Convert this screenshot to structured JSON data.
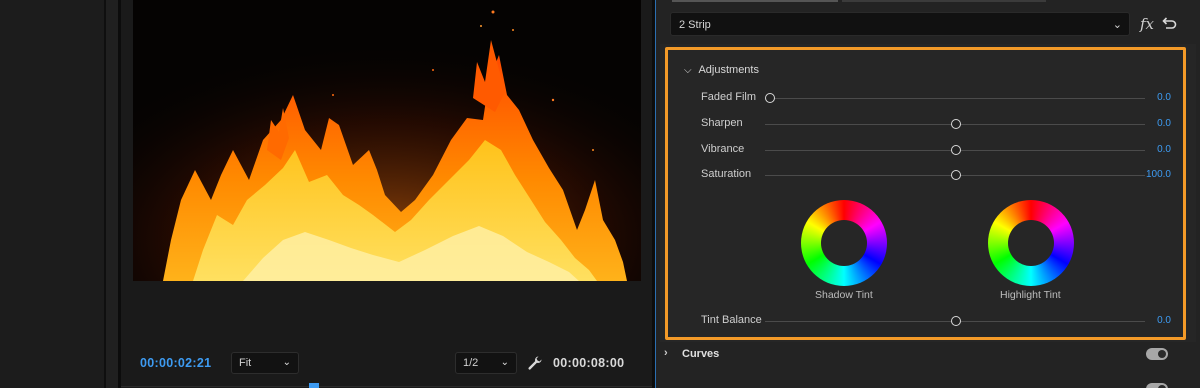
{
  "monitor": {
    "current_time": "00:00:02:21",
    "total_time": "00:00:08:00",
    "zoom": "Fit",
    "resolution": "1/2",
    "icons": [
      "wrench-icon",
      "chevron-down-icon"
    ]
  },
  "lumetri": {
    "preset": "2 Strip",
    "fx_label": "fx",
    "adjustments": {
      "title": "Adjustments",
      "sliders": [
        {
          "label": "Faded Film",
          "value": "0.0",
          "position": 0.0
        },
        {
          "label": "Sharpen",
          "value": "0.0",
          "position": 0.5
        },
        {
          "label": "Vibrance",
          "value": "0.0",
          "position": 0.5
        },
        {
          "label": "Saturation",
          "value": "100.0",
          "position": 0.5
        }
      ],
      "wheels": [
        {
          "label": "Shadow Tint"
        },
        {
          "label": "Highlight Tint"
        }
      ],
      "tint_balance": {
        "label": "Tint Balance",
        "value": "0.0",
        "position": 0.5
      }
    },
    "curves": {
      "label": "Curves",
      "enabled": true
    },
    "highlight_color": "#f39a28",
    "accent_color": "#3d9bf2"
  }
}
